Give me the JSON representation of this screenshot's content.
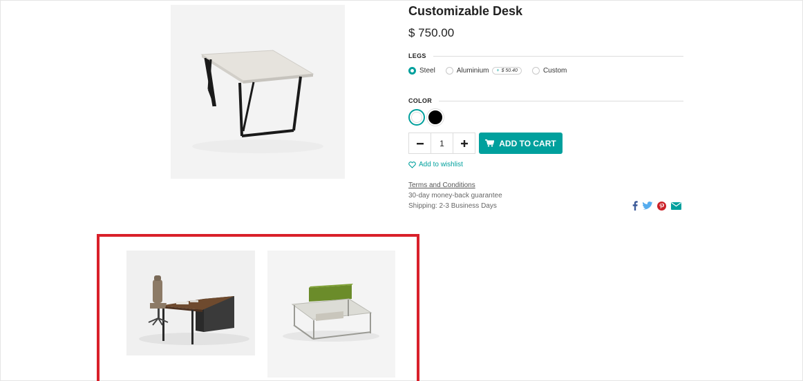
{
  "product": {
    "title": "Customizable Desk",
    "price": "$ 750.00"
  },
  "legs": {
    "label": "LEGS",
    "options": [
      {
        "label": "Steel",
        "selected": true
      },
      {
        "label": "Aluminium",
        "selected": false,
        "extra_price": "$ 50.40"
      },
      {
        "label": "Custom",
        "selected": false
      }
    ]
  },
  "color": {
    "label": "COLOR",
    "options": [
      {
        "name": "white",
        "hex": "#ffffff",
        "selected": true
      },
      {
        "name": "black",
        "hex": "#000000",
        "selected": false
      }
    ]
  },
  "quantity": {
    "value": "1",
    "decrement_icon": "minus-icon",
    "increment_icon": "plus-icon"
  },
  "cart": {
    "label": "ADD TO CART",
    "icon": "cart-icon"
  },
  "wishlist": {
    "label": "Add to wishlist",
    "icon": "heart-icon"
  },
  "terms": {
    "label": "Terms and Conditions",
    "guarantee": "30-day money-back guarantee",
    "shipping": "Shipping: 2-3 Business Days"
  },
  "share": {
    "icons": [
      "facebook-icon",
      "twitter-icon",
      "pinterest-icon",
      "email-icon"
    ]
  },
  "colors": {
    "accent": "#00a09d",
    "highlight_border": "#d9202a",
    "facebook": "#3b5998",
    "twitter": "#55acee",
    "pinterest": "#cb2027",
    "email": "#00a09d"
  },
  "thumbnails": [
    {
      "name": "office-desk-with-chair"
    },
    {
      "name": "double-workstation-desk"
    }
  ]
}
